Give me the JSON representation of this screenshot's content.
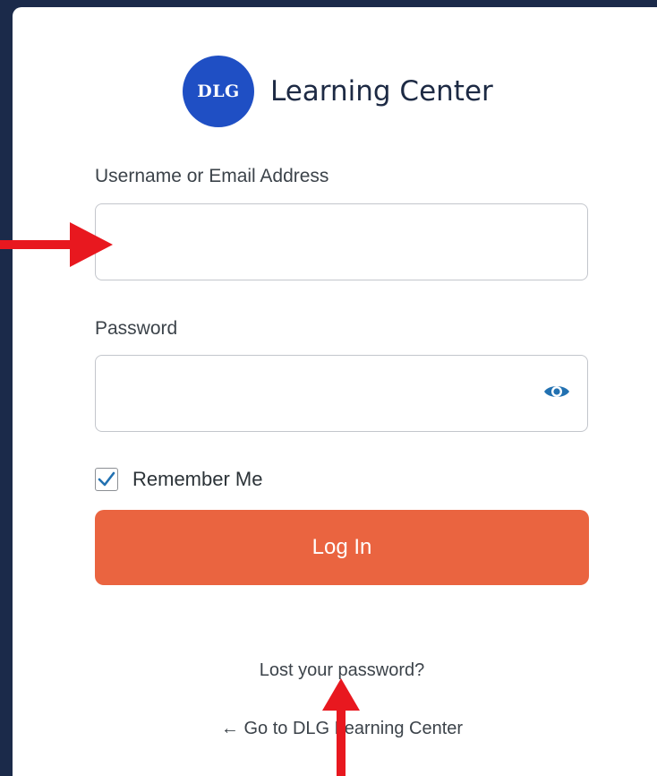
{
  "brand": {
    "logo_text": "DLG",
    "title": "Learning Center",
    "logo_color": "#1f4fc4"
  },
  "form": {
    "username_label": "Username or Email Address",
    "username_value": "",
    "password_label": "Password",
    "password_value": "",
    "remember_label": "Remember Me",
    "remember_checked": true,
    "login_label": "Log In",
    "login_color": "#ea6440"
  },
  "links": {
    "lost_password": "Lost your password?",
    "go_back": "← Go to DLG Learning Center"
  },
  "annotations": {
    "arrow_color": "#e8181f",
    "icons": [
      "password-visibility-eye-icon",
      "annotation-arrow-right",
      "annotation-arrow-up"
    ]
  }
}
